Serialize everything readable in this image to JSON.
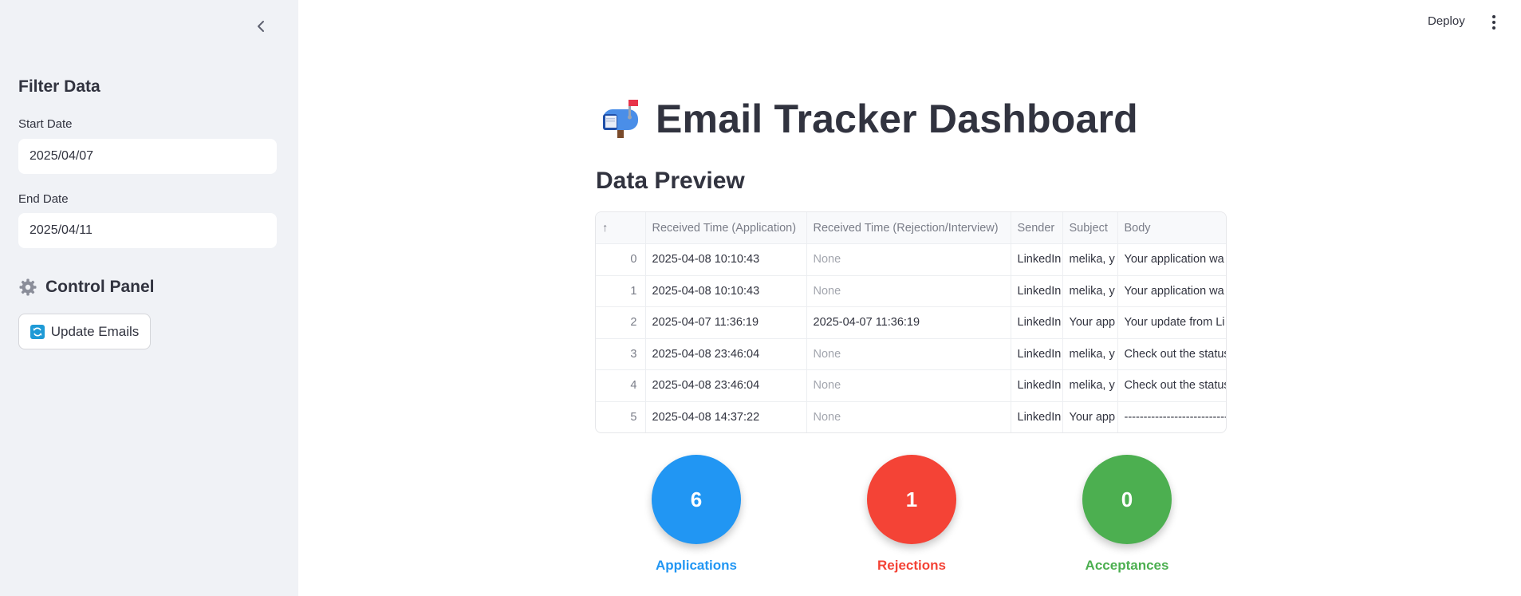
{
  "sidebar": {
    "filter_title": "Filter Data",
    "start_label": "Start Date",
    "start_value": "2025/04/07",
    "end_label": "End Date",
    "end_value": "2025/04/11",
    "control_title": "Control Panel",
    "update_button": "Update Emails"
  },
  "header": {
    "deploy_label": "Deploy"
  },
  "main": {
    "title": "Email Tracker Dashboard",
    "section_title": "Data Preview"
  },
  "table": {
    "sort_indicator": "↑",
    "columns": [
      "Received Time (Application)",
      "Received Time (Rejection/Interview)",
      "Sender",
      "Subject",
      "Body"
    ],
    "rows": [
      {
        "idx": "0",
        "app_time": "2025-04-08 10:10:43",
        "rej_time": "None",
        "sender": "LinkedIn",
        "subject": "melika, y",
        "body": "Your application wa"
      },
      {
        "idx": "1",
        "app_time": "2025-04-08 10:10:43",
        "rej_time": "None",
        "sender": "LinkedIn",
        "subject": "melika, y",
        "body": "Your application wa"
      },
      {
        "idx": "2",
        "app_time": "2025-04-07 11:36:19",
        "rej_time": "2025-04-07 11:36:19",
        "sender": "LinkedIn",
        "subject": "Your app",
        "body": "Your update from Li"
      },
      {
        "idx": "3",
        "app_time": "2025-04-08 23:46:04",
        "rej_time": "None",
        "sender": "LinkedIn",
        "subject": "melika, y",
        "body": "Check out the status"
      },
      {
        "idx": "4",
        "app_time": "2025-04-08 23:46:04",
        "rej_time": "None",
        "sender": "LinkedIn",
        "subject": "melika, y",
        "body": "Check out the status"
      },
      {
        "idx": "5",
        "app_time": "2025-04-08 14:37:22",
        "rej_time": "None",
        "sender": "LinkedIn",
        "subject": "Your app",
        "body": "-----------------------------"
      }
    ]
  },
  "stats": [
    {
      "value": "6",
      "label": "Applications",
      "color": "#2196f3"
    },
    {
      "value": "1",
      "label": "Rejections",
      "color": "#f44336"
    },
    {
      "value": "0",
      "label": "Acceptances",
      "color": "#4caf50"
    }
  ],
  "icons": {
    "collapse": "chevron-left-icon",
    "menu": "kebab-menu-icon",
    "control": "gear-icon",
    "update": "refresh-icon",
    "title": "mailbox-icon"
  }
}
